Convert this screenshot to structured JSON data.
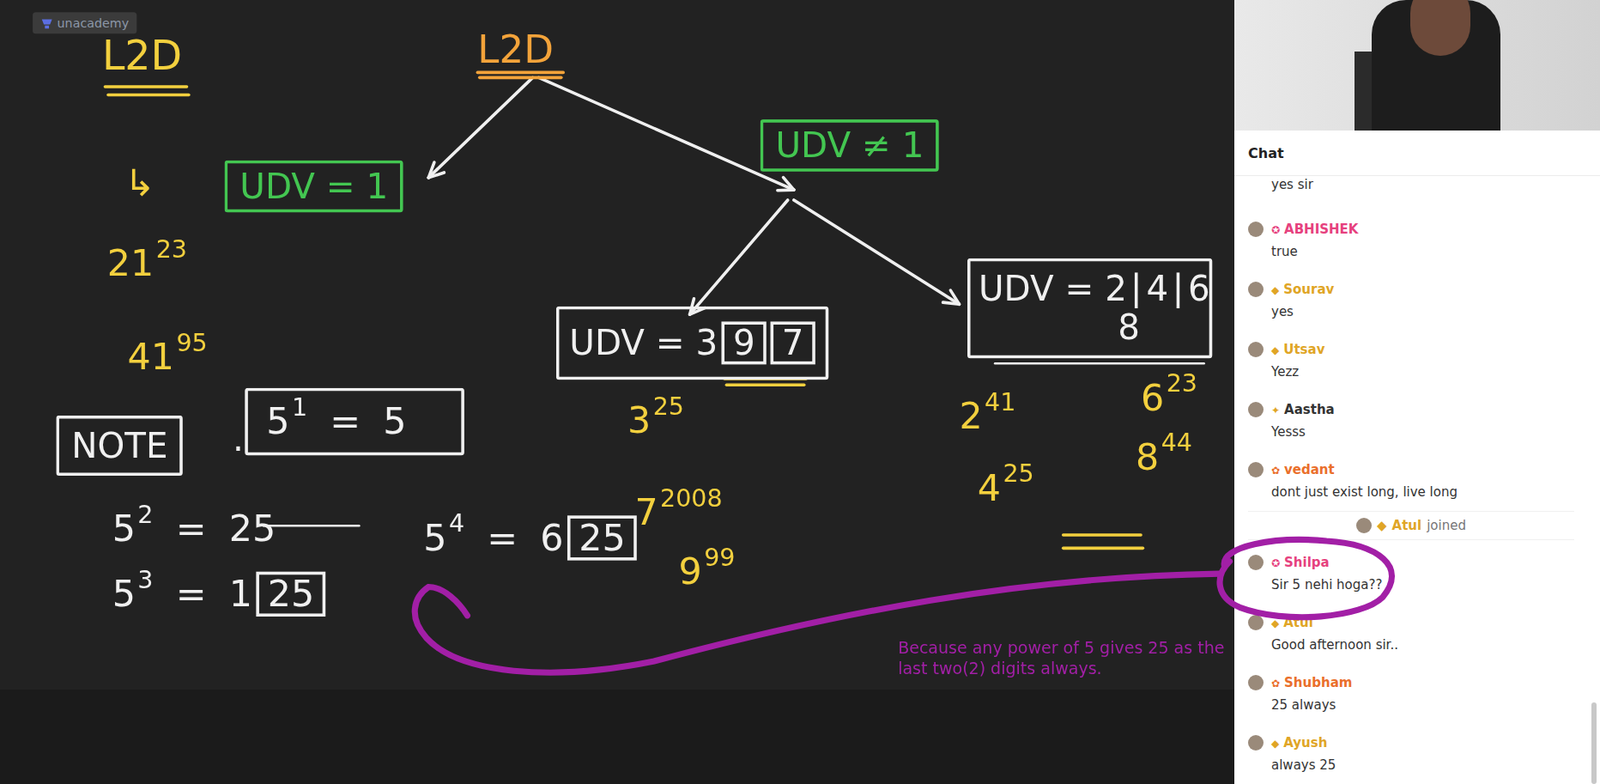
{
  "app": {
    "logo": "unacademy"
  },
  "board": {
    "heading": "L2D",
    "arrow_mark": "↳",
    "tree": {
      "root": "L2D",
      "left": "UDV = 1",
      "right": "UDV ≠ 1",
      "odd": {
        "label": "UDV = ",
        "digits": [
          "3",
          "9",
          "7"
        ]
      },
      "even": {
        "label": "UDV = ",
        "digits": [
          "2",
          "4",
          "6",
          "8"
        ]
      }
    },
    "examples": [
      {
        "base": "21",
        "exp": "23"
      },
      {
        "base": "41",
        "exp": "95"
      },
      {
        "base": "3",
        "exp": "25"
      },
      {
        "base": "7",
        "exp": "2008"
      },
      {
        "base": "9",
        "exp": "99"
      },
      {
        "base": "2",
        "exp": "41"
      },
      {
        "base": "6",
        "exp": "23"
      },
      {
        "base": "4",
        "exp": "25"
      },
      {
        "base": "8",
        "exp": "44"
      }
    ],
    "note": {
      "label": "NOTE",
      "dot": ".",
      "rules": [
        {
          "base": "5",
          "exp": "1",
          "eq": "=",
          "lead": "5",
          "boxed": ""
        },
        {
          "base": "5",
          "exp": "2",
          "eq": "=",
          "lead": "25",
          "boxed": ""
        },
        {
          "base": "5",
          "exp": "3",
          "eq": "=",
          "lead": "1",
          "boxed": "25"
        },
        {
          "base": "5",
          "exp": "4",
          "eq": "=",
          "lead": "6",
          "boxed": "25"
        }
      ]
    },
    "annotation": "Because any power of 5 gives 25 as the last two(2) digits always."
  },
  "chat": {
    "title": "Chat",
    "messages": [
      {
        "kind": "message",
        "text": "yes sir"
      },
      {
        "kind": "message",
        "badge": "✪",
        "name": "ABHISHEK",
        "text": "true",
        "color": "#e6417e"
      },
      {
        "kind": "message",
        "badge": "◆",
        "name": "Sourav",
        "text": "yes",
        "color": "#e0a526"
      },
      {
        "kind": "message",
        "badge": "◆",
        "name": "Utsav",
        "text": "Yezz",
        "color": "#e0a526"
      },
      {
        "kind": "message",
        "badge": "✦",
        "name": "Aastha",
        "text": "Yesss",
        "color": "#333333"
      },
      {
        "kind": "message",
        "badge": "✿",
        "name": "vedant",
        "text": "dont just exist long, live long",
        "color": "#ea6f2b"
      },
      {
        "kind": "system",
        "badge": "◆",
        "name": "Atul",
        "text": "joined",
        "color": "#e0a526"
      },
      {
        "kind": "message",
        "badge": "✪",
        "name": "Shilpa",
        "text": "Sir 5 nehi hoga??",
        "color": "#e6417e"
      },
      {
        "kind": "message",
        "badge": "◆",
        "name": "Atul",
        "text": "Good afternoon sir..",
        "color": "#e0a526"
      },
      {
        "kind": "message",
        "badge": "✿",
        "name": "Shubham",
        "text": "25 always",
        "color": "#ea6f2b"
      },
      {
        "kind": "message",
        "badge": "◆",
        "name": "Ayush",
        "text": "always 25",
        "color": "#e0a526"
      }
    ]
  }
}
